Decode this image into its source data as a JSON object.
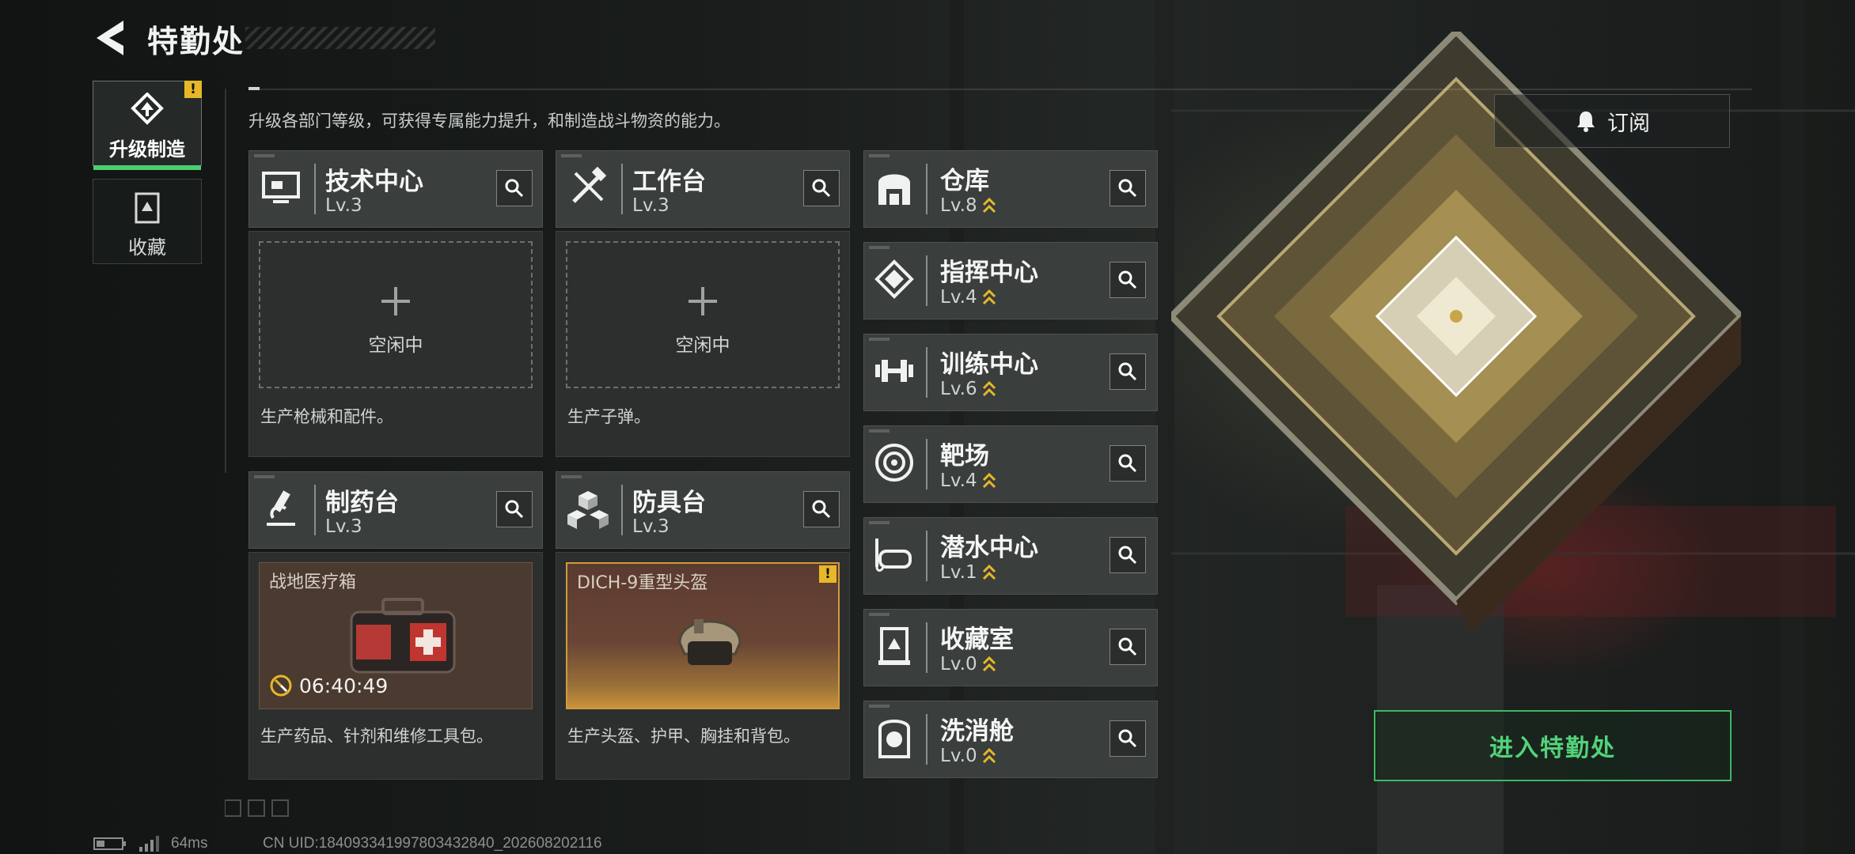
{
  "header": {
    "title": "特勤处"
  },
  "tabs": [
    {
      "label": "升级制造",
      "badge": "!",
      "active": true
    },
    {
      "label": "收藏",
      "active": false
    }
  ],
  "description": "升级各部门等级，可获得专属能力提升，和制造战斗物资的能力。",
  "subscribe_label": "订阅",
  "stations": {
    "tech": {
      "name": "技术中心",
      "level": "Lv.3",
      "idle": "空闲中",
      "desc": "生产枪械和配件。"
    },
    "workbench": {
      "name": "工作台",
      "level": "Lv.3",
      "idle": "空闲中",
      "desc": "生产子弹。"
    },
    "pharmacy": {
      "name": "制药台",
      "level": "Lv.3",
      "product": "战地医疗箱",
      "timer": "06:40:49",
      "desc": "生产药品、针剂和维修工具包。"
    },
    "armor": {
      "name": "防具台",
      "level": "Lv.3",
      "product": "DICH-9重型头盔",
      "badge": "!",
      "desc": "生产头盔、护甲、胸挂和背包。"
    }
  },
  "facilities": [
    {
      "name": "仓库",
      "level": "Lv.8",
      "icon": "warehouse-icon"
    },
    {
      "name": "指挥中心",
      "level": "Lv.4",
      "icon": "command-icon"
    },
    {
      "name": "训练中心",
      "level": "Lv.6",
      "icon": "dumbbell-icon"
    },
    {
      "name": "靶场",
      "level": "Lv.4",
      "icon": "target-icon"
    },
    {
      "name": "潜水中心",
      "level": "Lv.1",
      "icon": "diving-mask-icon"
    },
    {
      "name": "收藏室",
      "level": "Lv.0",
      "icon": "collection-icon"
    },
    {
      "name": "洗消舱",
      "level": "Lv.0",
      "icon": "decontamination-icon"
    }
  ],
  "enter_label": "进入特勤处",
  "status": {
    "ping": "64ms",
    "uid": "CN UID:1840933419978034328​40_202608202116"
  },
  "colors": {
    "accent_green": "#4bd06f",
    "badge_yellow": "#e6b829",
    "upgrade_arrow": "#e6b829"
  }
}
